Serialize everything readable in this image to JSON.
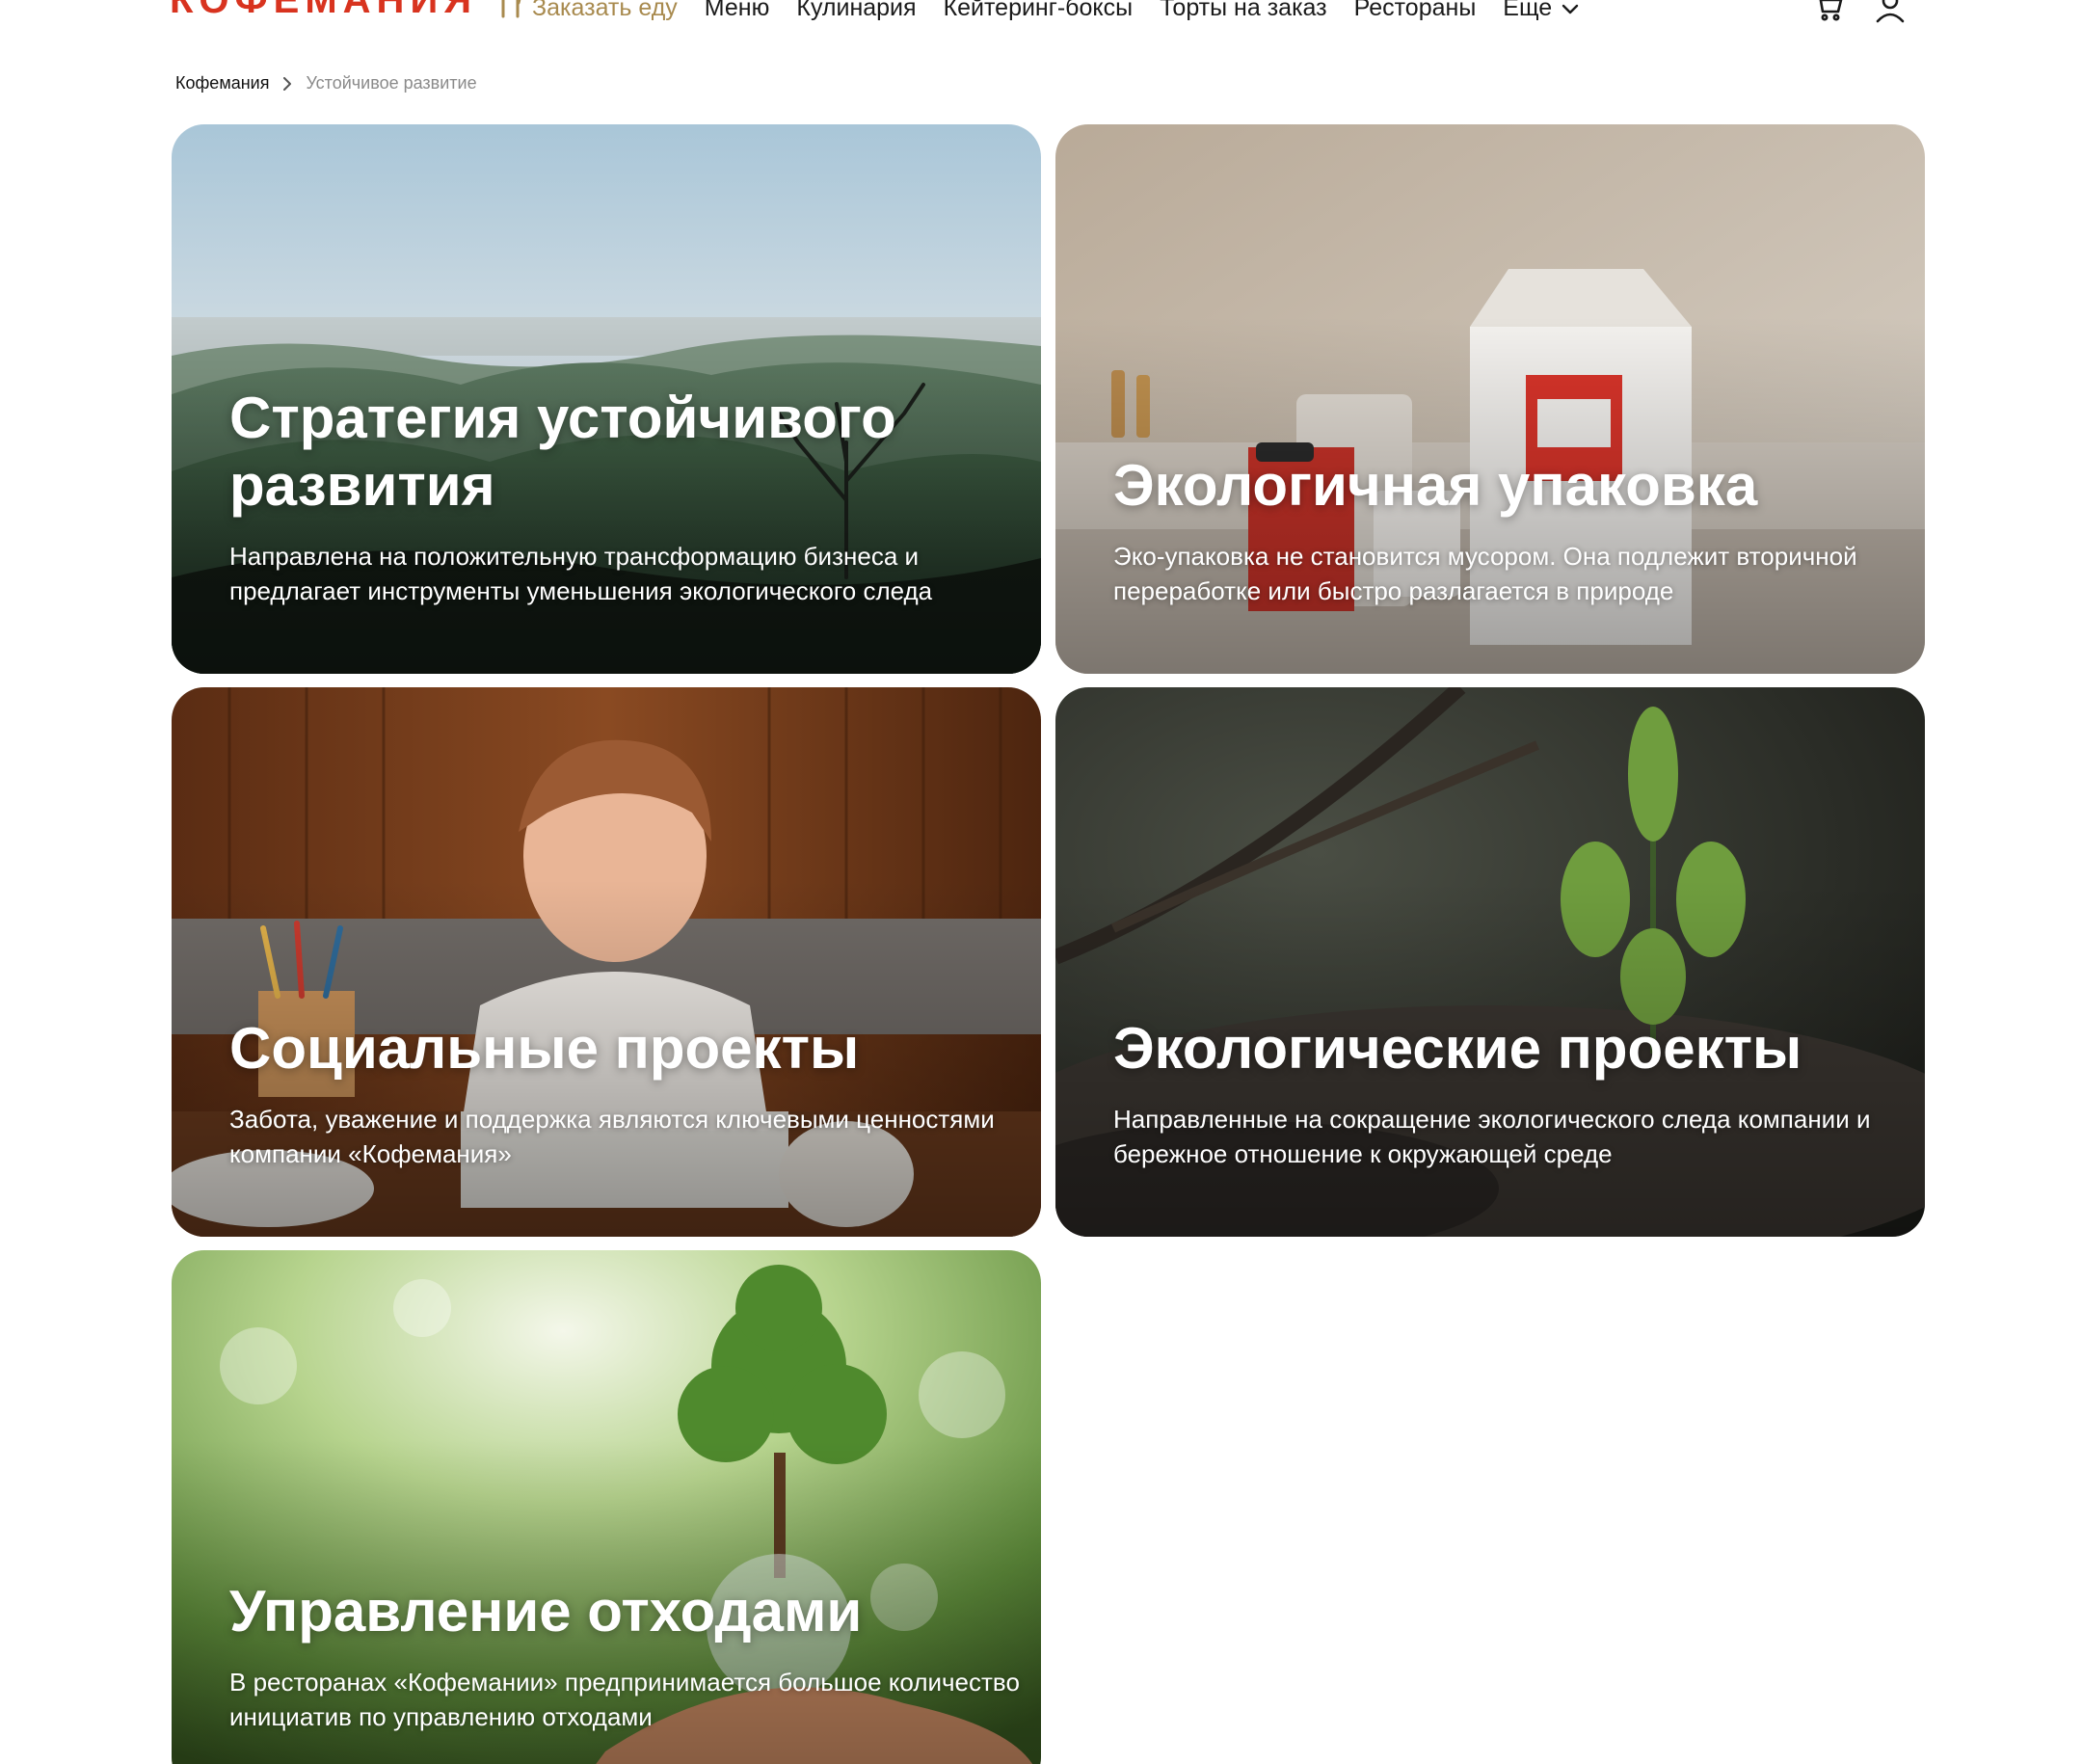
{
  "brand": {
    "logo_text": "КОФЕМАНИЯ",
    "accent": "#d8331f",
    "order_color": "#a88a4e"
  },
  "nav": {
    "order_label": "Заказать еду",
    "items": [
      {
        "label": "Меню"
      },
      {
        "label": "Кулинария"
      },
      {
        "label": "Кейтеринг-боксы"
      },
      {
        "label": "Торты на заказ"
      },
      {
        "label": "Рестораны"
      }
    ],
    "more_label": "Еще",
    "icons": [
      "fork-knife-icon",
      "cart-icon",
      "user-icon",
      "chevron-down-icon"
    ]
  },
  "breadcrumb": {
    "home": "Кофемания",
    "current": "Устойчивое развитие"
  },
  "cards": [
    {
      "title": "Стратегия устойчивого развития",
      "description": "Направлена на положительную трансформацию бизнеса и предлагает инструменты уменьшения экологического следа"
    },
    {
      "title": "Экологичная упаковка",
      "description": "Эко-упаковка не становится мусором. Она подлежит вторичной переработке или быстро разлагается в природе"
    },
    {
      "title": "Социальные проекты",
      "description": "Забота, уважение и поддержка являются ключевыми ценностями компании «Кофемания»"
    },
    {
      "title": "Экологические проекты",
      "description": "Направленные на сокращение экологического следа компании и бережное отношение к окружающей среде"
    },
    {
      "title": "Управление отходами",
      "description": "В ресторанах «Кофемании» предпринимается большое количество инициатив по управлению отходами"
    }
  ]
}
